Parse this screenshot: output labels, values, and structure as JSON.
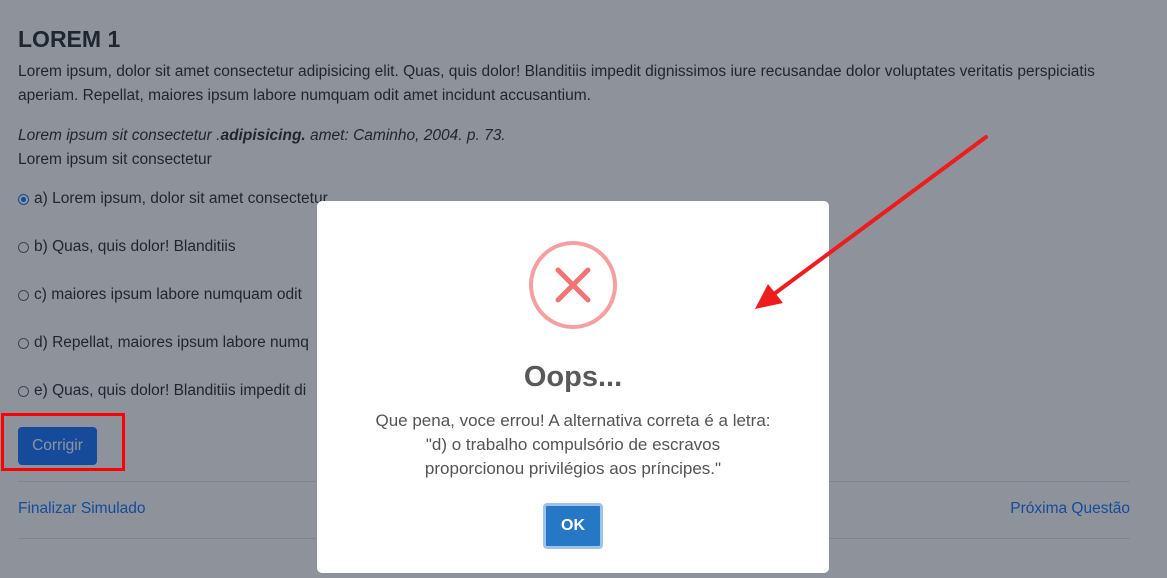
{
  "question": {
    "title": "LOREM 1",
    "text": "Lorem ipsum, dolor sit amet consectetur adipisicing elit. Quas, quis dolor! Blanditiis impedit dignissimos iure recusandae dolor voluptates veritatis perspiciatis aperiam. Repellat, maiores ipsum labore numquam odit amet incidunt accusantium.",
    "citation_pre": "Lorem ipsum sit consectetur .",
    "citation_bold": "adipisicing.",
    "citation_post": " amet: Caminho, 2004. p. 73.",
    "subtitle": "Lorem ipsum sit consectetur",
    "options": [
      {
        "label": "a) Lorem ipsum, dolor sit amet consectetur",
        "checked": true
      },
      {
        "label": "b) Quas, quis dolor! Blanditiis",
        "checked": false
      },
      {
        "label": "c) maiores ipsum labore numquam odit",
        "checked": false
      },
      {
        "label": "d) Repellat, maiores ipsum labore numq",
        "checked": false
      },
      {
        "label": "e) Quas, quis dolor! Blanditiis impedit di",
        "checked": false
      }
    ]
  },
  "actions": {
    "corrigir_label": "Corrigir",
    "finish_label": "Finalizar Simulado",
    "next_label": "Próxima Questão"
  },
  "modal": {
    "icon": "error-x-icon",
    "title": "Oops...",
    "line1": "Que pena, voce errou! A alternativa correta é a letra:",
    "line2": "\"d) o trabalho compulsório de escravos",
    "line3": "proporcionou privilégios aos príncipes.\"",
    "ok_label": "OK"
  },
  "colors": {
    "primary": "#0d6efd",
    "modal_button": "#2778c4",
    "error": "#f27474",
    "annotation": "#ff0000"
  }
}
